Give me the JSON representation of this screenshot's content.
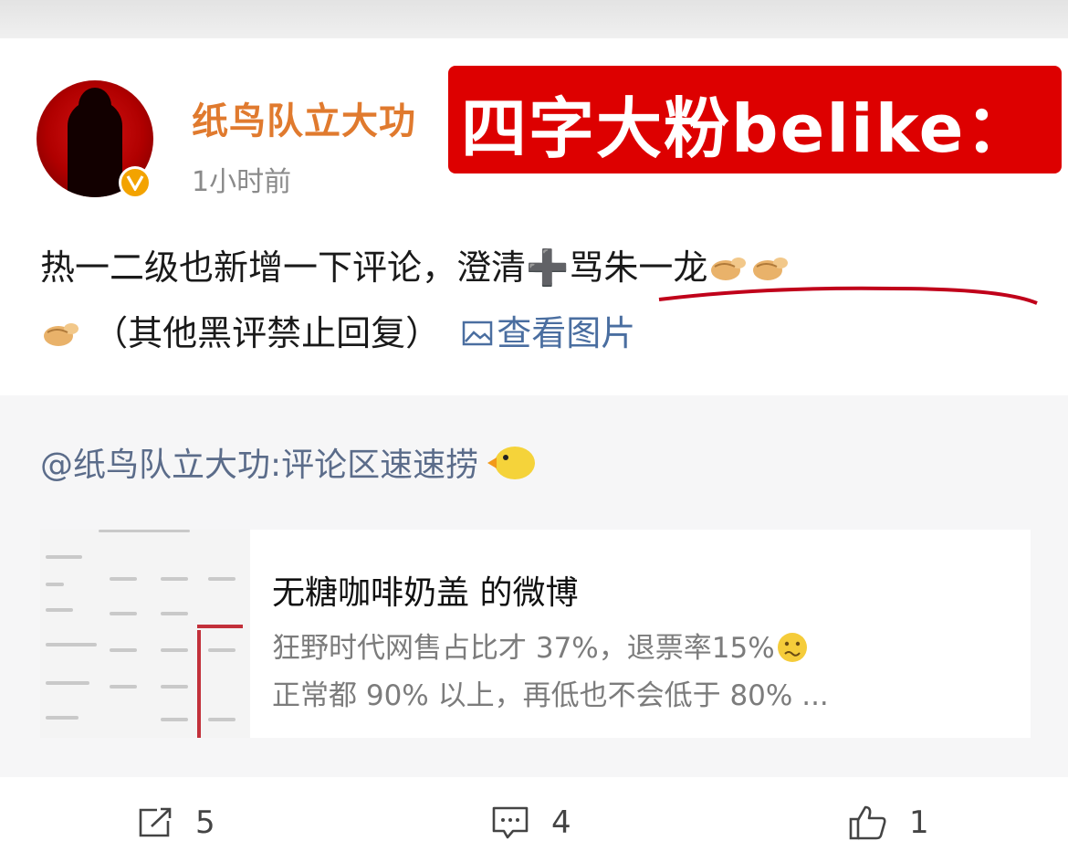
{
  "post": {
    "author": "纸鸟队立大功",
    "time": "1小时前",
    "overlay_caption": "四字大粉belike：",
    "text_line1": "热一二级也新增一下评论，澄清➕骂朱一龙",
    "text_line2": "（其他黑评禁止回复）",
    "view_image_label": "查看图片"
  },
  "repost": {
    "text": "@纸鸟队立大功:评论区速速捞",
    "card": {
      "title": "无糖咖啡奶盖 的微博",
      "desc_line1": "狂野时代网售占比才 37%，退票率15%",
      "desc_line2": "正常都 90% 以上，再低也不会低于 80% ..."
    }
  },
  "actions": {
    "repost_count": "5",
    "comment_count": "4",
    "like_count": "1"
  },
  "icons": [
    "verified-badge-icon",
    "clap-emoji-icon",
    "image-icon",
    "chick-emoji-icon",
    "thinking-emoji-icon",
    "repost-icon",
    "comment-icon",
    "like-icon"
  ],
  "colors": {
    "username": "#e07a2e",
    "overlay": "#dd0000",
    "link": "#4a6ea0"
  }
}
